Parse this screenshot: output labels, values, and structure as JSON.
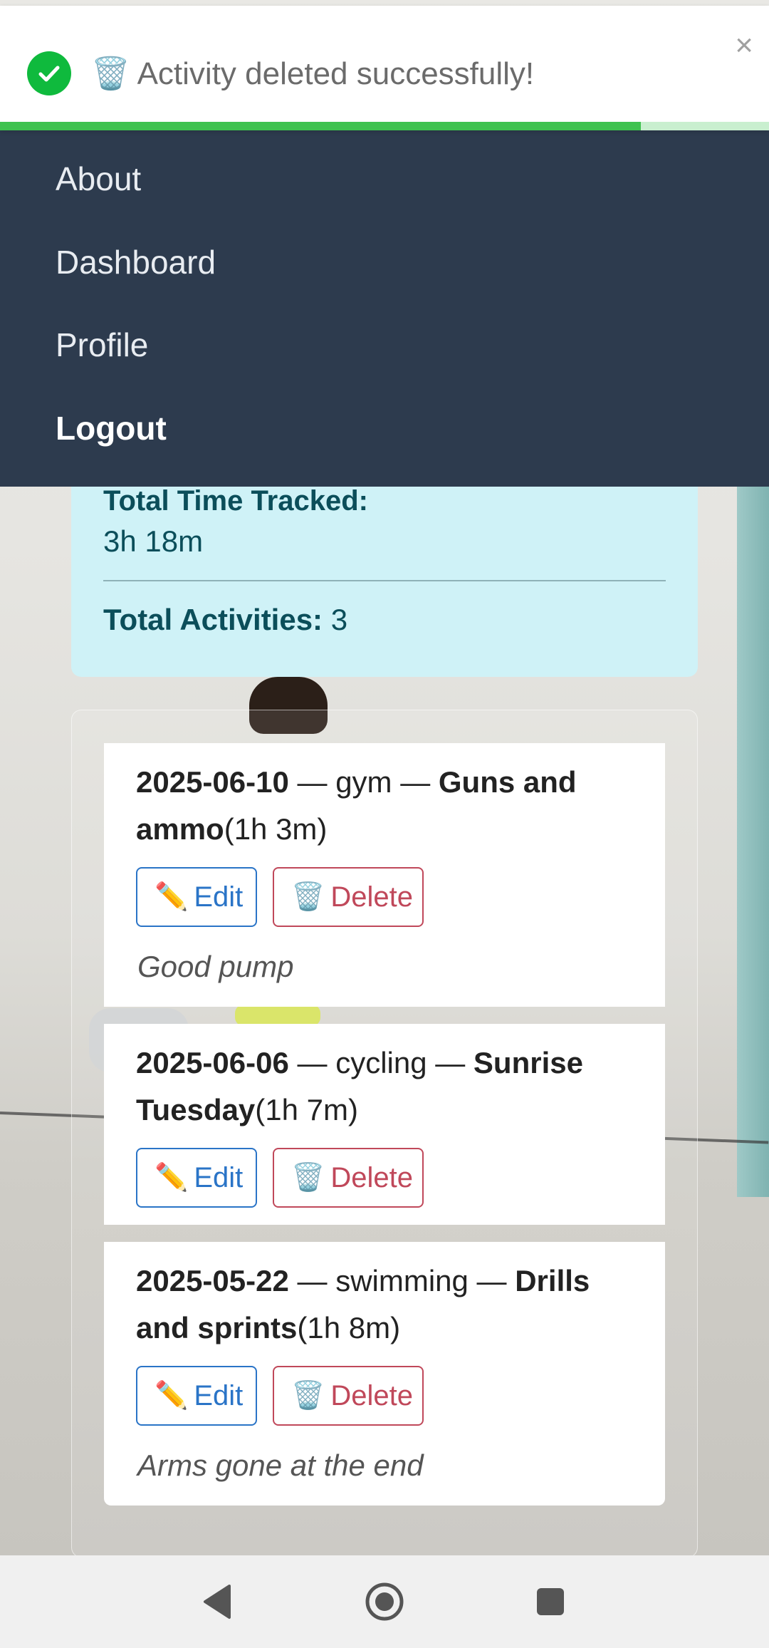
{
  "toast": {
    "icon": "check-circle-icon",
    "message": "🗑️ Activity deleted successfully!",
    "close_label": "×",
    "progress_fraction": 0.833,
    "colors": {
      "success": "#0fba3d",
      "progress": "#3fc24f"
    }
  },
  "nav": {
    "items": [
      {
        "label": "About"
      },
      {
        "label": "Dashboard"
      },
      {
        "label": "Profile"
      },
      {
        "label": "Logout"
      }
    ],
    "background": "#2d3b4e"
  },
  "stats": {
    "total_time_label": "Total Time Tracked:",
    "total_time_value": "3h 18m",
    "total_activities_label": "Total Activities:",
    "total_activities_value": "3"
  },
  "activities": [
    {
      "date": "2025-06-10",
      "sep1": " — ",
      "type": "gym",
      "sep2": " — ",
      "name": "Guns and ammo",
      "duration": "(1h 3m)",
      "edit_label": "Edit",
      "delete_label": "Delete",
      "note": "Good pump"
    },
    {
      "date": "2025-06-06",
      "sep1": " — ",
      "type": "cycling",
      "sep2": " — ",
      "name": "Sunrise Tuesday",
      "duration": "(1h 7m)",
      "edit_label": "Edit",
      "delete_label": "Delete",
      "note": ""
    },
    {
      "date": "2025-05-22",
      "sep1": " — ",
      "type": "swimming",
      "sep2": " — ",
      "name": "Drills and sprints",
      "duration": "(1h 8m)",
      "edit_label": "Edit",
      "delete_label": "Delete",
      "note": "Arms gone at the end"
    }
  ],
  "icons": {
    "edit": "✏️",
    "delete": "🗑️"
  },
  "system_nav": [
    "back-icon",
    "home-icon",
    "recents-icon"
  ]
}
